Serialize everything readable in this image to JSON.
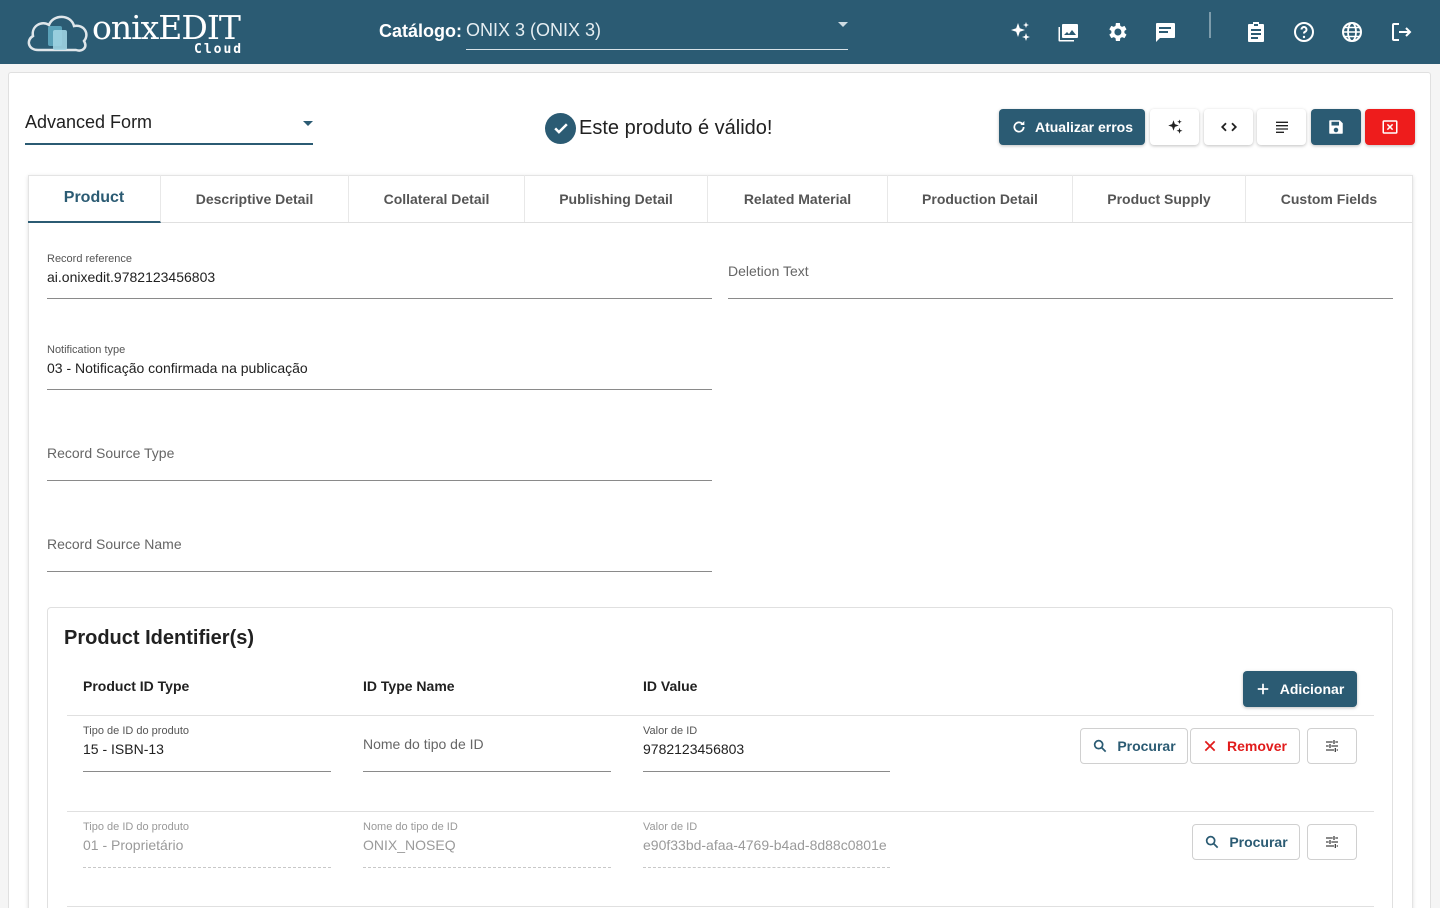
{
  "app": {
    "logo_name": "onixEDIT",
    "logo_sub": "Cloud",
    "catalog_label": "Catálogo:",
    "catalog_value": "ONIX 3 (ONIX 3)",
    "toolbar_icons": [
      "ai-sparkle-icon",
      "image-icon",
      "settings-gear-icon",
      "comment-icon",
      "clipboard-icon",
      "help-icon",
      "globe-icon",
      "logout-icon"
    ]
  },
  "toolbar": {
    "form_select": "Advanced Form",
    "validity": "Este produto é válido!",
    "refresh_label": "Atualizar erros",
    "buttons": [
      "ai-sparkle-icon",
      "code-icon",
      "list-icon",
      "save-icon",
      "close-icon"
    ]
  },
  "tabs": [
    {
      "label": "Product"
    },
    {
      "label": "Descriptive Detail"
    },
    {
      "label": "Collateral Detail"
    },
    {
      "label": "Publishing Detail"
    },
    {
      "label": "Related Material"
    },
    {
      "label": "Production Detail"
    },
    {
      "label": "Product Supply"
    },
    {
      "label": "Custom Fields"
    }
  ],
  "fields": {
    "record_reference": {
      "label": "Record reference",
      "value": "ai.onixedit.9782123456803"
    },
    "deletion_text": {
      "placeholder": "Deletion Text"
    },
    "notification_type": {
      "label": "Notification type",
      "value": "03 - Notificação confirmada na publicação"
    },
    "record_source_type": {
      "placeholder": "Record Source Type"
    },
    "record_source_name": {
      "placeholder": "Record Source Name"
    }
  },
  "identifiers": {
    "title": "Product Identifier(s)",
    "columns": [
      "Product ID Type",
      "ID Type Name",
      "ID Value"
    ],
    "add_label": "Adicionar",
    "search_label": "Procurar",
    "remove_label": "Remover",
    "rows": [
      {
        "type_label": "Tipo de ID do produto",
        "type_value": "15 - ISBN-13",
        "name_placeholder": "Nome do tipo de ID",
        "value_label": "Valor de ID",
        "value": "9782123456803"
      },
      {
        "type_label": "Tipo de ID do produto",
        "type_value": "01 - Proprietário",
        "name_label": "Nome do tipo de ID",
        "name_value": "ONIX_NOSEQ",
        "value_label": "Valor de ID",
        "value": "e90f33bd-afaa-4769-b4ad-8d88c0801e"
      }
    ]
  },
  "colors": {
    "brand": "#2b5b73",
    "danger": "#ee1c1c"
  }
}
